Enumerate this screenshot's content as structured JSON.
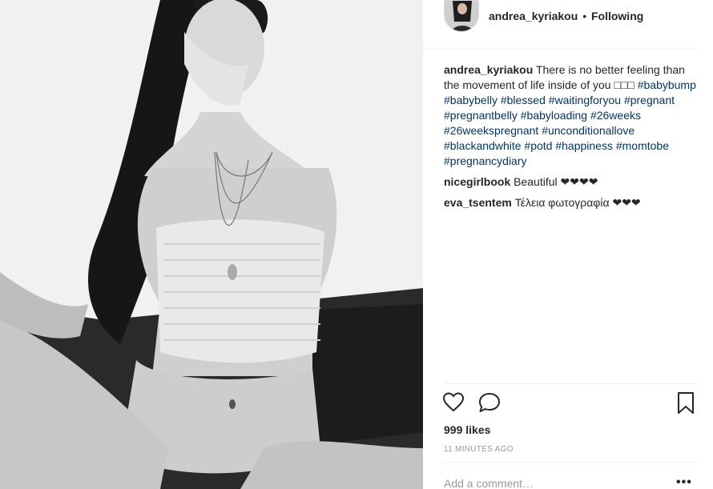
{
  "post": {
    "author": "andrea_kyriakou",
    "separator": "•",
    "follow_status": "Following",
    "caption": {
      "user": "andrea_kyriakou",
      "text": "There is no better feeling than the movement of life inside of you □□□",
      "hashtags": [
        "#babybump",
        "#babybelly",
        "#blessed",
        "#waitingforyou",
        "#pregnant",
        "#pregnantbelly",
        "#babyloading",
        "#26weeks",
        "#26weekspregnant",
        "#unconditionallove",
        "#blackandwhite",
        "#potd",
        "#happiness",
        "#momtobe",
        "#pregnancydiary"
      ]
    },
    "comments": [
      {
        "user": "nicegirlbook",
        "text": "Beautiful ❤❤❤❤"
      },
      {
        "user": "eva_tsentem",
        "text": "Τέλεια φωτογραφία ❤❤❤"
      }
    ],
    "likes": "999 likes",
    "timestamp": "11 MINUTES AGO",
    "add_comment_placeholder": "Add a comment…",
    "more_label": "•••"
  },
  "icons": {
    "like": "heart-icon",
    "comment": "speech-bubble-icon",
    "save": "bookmark-icon",
    "more": "more-options-icon"
  }
}
